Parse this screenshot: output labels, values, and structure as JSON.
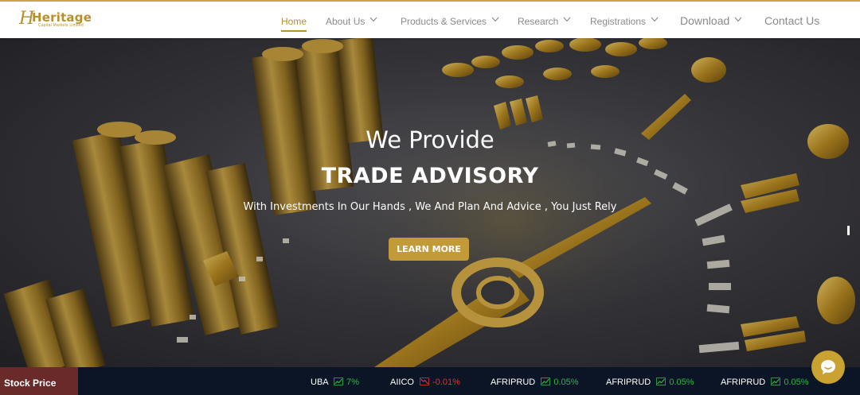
{
  "brand": {
    "logo_mark": "H",
    "name": "Heritage",
    "tagline": "Capital Markets Limited"
  },
  "nav": {
    "items": [
      {
        "label": "Home",
        "active": true,
        "dropdown": false
      },
      {
        "label": "About Us",
        "dropdown": true
      },
      {
        "label": "Products & Services",
        "dropdown": true
      },
      {
        "label": "Research",
        "dropdown": true
      },
      {
        "label": "Registrations",
        "dropdown": true
      },
      {
        "label": "Download",
        "dropdown": true
      },
      {
        "label": "Contact Us",
        "dropdown": false
      }
    ]
  },
  "hero": {
    "subtitle": "We Provide",
    "title": "TRADE ADVISORY",
    "tagline": "With Investments In Our Hands , We And Plan And Advice , You Just Rely",
    "cta": "LEARN MORE"
  },
  "ticker": {
    "label": "Stock Price",
    "items": [
      {
        "symbol": "UBA",
        "change": "7%",
        "direction": "up"
      },
      {
        "symbol": "AIICO",
        "change": "-0.01%",
        "direction": "down"
      },
      {
        "symbol": "AFRIPRUD",
        "change": "0.05%",
        "direction": "up"
      },
      {
        "symbol": "AFRIPRUD",
        "change": "0.05%",
        "direction": "up"
      },
      {
        "symbol": "AFRIPRUD",
        "change": "0.05%",
        "direction": "up"
      }
    ]
  },
  "colors": {
    "accent": "#c29b38",
    "nav_text": "#8a8a8a",
    "ticker_bg": "#0c1525",
    "ticker_label_bg": "#6b2a2a",
    "up": "#2fb34a",
    "down": "#e2322e"
  },
  "icons": {
    "chevron": "chevron-down-icon",
    "chat": "chat-icon",
    "trend_up": "trend-up-icon",
    "trend_down": "trend-down-icon"
  }
}
